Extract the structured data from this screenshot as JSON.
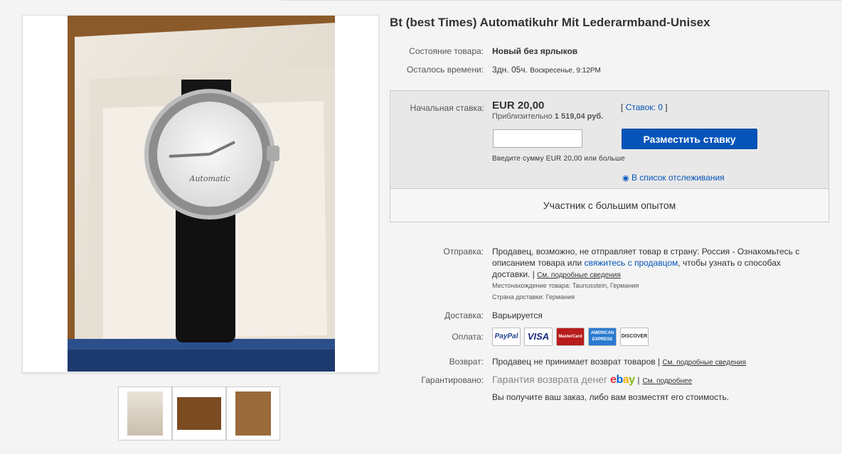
{
  "title": "Bt (best Times) Automatikuhr Mit Lederarmband-Unisex",
  "condition": {
    "label": "Состояние товара:",
    "value": "Новый без ярлыков"
  },
  "time_left": {
    "label": "Осталось времени:",
    "value": "3дн. 05ч.",
    "detail": "Воскресенье, 9:12PM"
  },
  "bid": {
    "label": "Начальная ставка:",
    "price": "EUR 20,00",
    "approx_prefix": "Приблизительно",
    "approx_value": "1 519,04 руб.",
    "bids_open": "[",
    "bids_link": "Ставок: 0",
    "bids_close": "]",
    "input_value": "",
    "button": "Разместить ставку",
    "hint": "Введите сумму EUR 20,00 или больше",
    "watchlist": "В список отслеживания",
    "seller_badge": "Участник с большим опытом"
  },
  "shipping": {
    "label": "Отправка:",
    "text1": "Продавец, возможно, не отправляет товар в страну: Россия - Ознакомьтесь с",
    "text2a": "описанием товара или",
    "text2link": "свяжитесь с продавцом",
    "text2b": ", чтобы узнать о способах",
    "text3": "доставки. |",
    "details_link": "См. подробные сведения",
    "location": "Местонахождение товара: Taunusstein, Германия",
    "country": "Страна доставки: Германия"
  },
  "delivery": {
    "label": "Доставка:",
    "value": "Варьируется"
  },
  "payments": {
    "label": "Оплата:",
    "items": [
      "PayPal",
      "VISA",
      "MasterCard",
      "AMERICAN EXPRESS",
      "DISCOVER"
    ]
  },
  "returns": {
    "label": "Возврат:",
    "value": "Продавец не принимает возврат товаров |",
    "link": "См. подробные сведения"
  },
  "guarantee": {
    "label": "Гарантировано:",
    "text": "Гарантия возврата денег",
    "logo": "ebay",
    "sep": "|",
    "link": "См. подробнее",
    "note": "Вы получите ваш заказ, либо вам возместят его стоимость."
  },
  "watch_dial_text": "Automatic",
  "colors": {
    "accent": "#0654ba"
  }
}
